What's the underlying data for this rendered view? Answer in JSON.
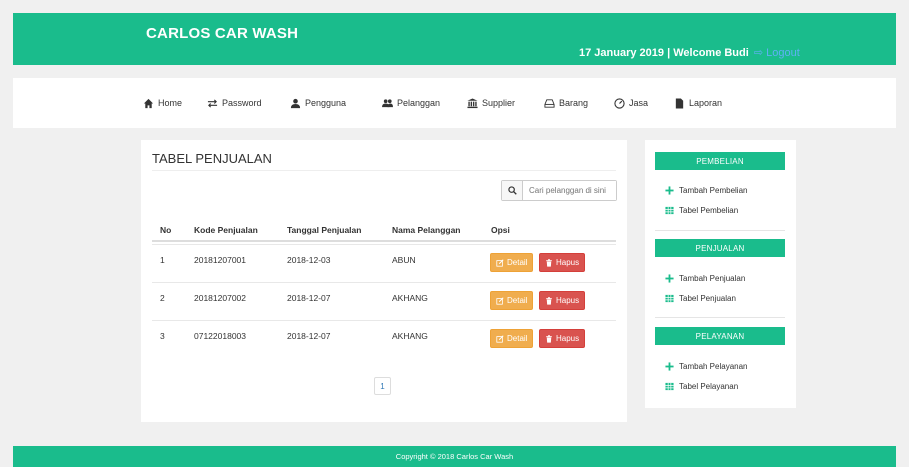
{
  "header": {
    "brand": "CARLOS CAR WASH",
    "date": "17 January 2019",
    "separator": " | ",
    "welcome": "Welcome Budi",
    "logout_label": "Logout"
  },
  "nav": [
    {
      "label": "Home",
      "icon": "home-icon"
    },
    {
      "label": "Password",
      "icon": "exchange-icon"
    },
    {
      "label": "Pengguna",
      "icon": "user-icon"
    },
    {
      "label": "Pelanggan",
      "icon": "users-icon"
    },
    {
      "label": "Supplier",
      "icon": "bank-icon"
    },
    {
      "label": "Barang",
      "icon": "hdd-icon"
    },
    {
      "label": "Jasa",
      "icon": "dashboard-icon"
    },
    {
      "label": "Laporan",
      "icon": "file-icon"
    }
  ],
  "main": {
    "title": "TABEL PENJUALAN",
    "search": {
      "placeholder": "Cari pelanggan di sini",
      "value": ""
    },
    "columns": [
      "No",
      "Kode Penjualan",
      "Tanggal Penjualan",
      "Nama Pelanggan",
      "Opsi"
    ],
    "rows": [
      {
        "no": "1",
        "kode": "20181207001",
        "tanggal": "2018-12-03",
        "nama": "ABUN"
      },
      {
        "no": "2",
        "kode": "20181207002",
        "tanggal": "2018-12-07",
        "nama": "AKHANG"
      },
      {
        "no": "3",
        "kode": "07122018003",
        "tanggal": "2018-12-07",
        "nama": "AKHANG"
      }
    ],
    "detail_label": "Detail",
    "hapus_label": "Hapus",
    "pagination": [
      "1"
    ]
  },
  "sidebar": {
    "sections": [
      {
        "heading": "PEMBELIAN",
        "links": [
          "Tambah Pembelian",
          "Tabel Pembelian"
        ]
      },
      {
        "heading": "PENJUALAN",
        "links": [
          "Tambah Penjualan",
          "Tabel Penjualan"
        ]
      },
      {
        "heading": "PELAYANAN",
        "links": [
          "Tambah Pelayanan",
          "Tabel Pelayanan"
        ]
      }
    ]
  },
  "footer": {
    "text": "Copyright © 2018 Carlos Car Wash"
  },
  "colors": {
    "primary": "#1abc8c",
    "warning": "#f0ad4e",
    "danger": "#d9534f",
    "link": "#5fb0f3"
  }
}
